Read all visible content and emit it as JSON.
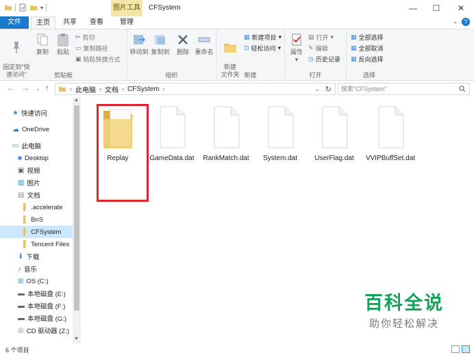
{
  "window": {
    "title": "CFSystem",
    "context_tab": "图片工具",
    "controls": {
      "minimize": "—",
      "maximize": "☐",
      "close": "✕"
    }
  },
  "tabs": [
    {
      "label": "文件"
    },
    {
      "label": "主页"
    },
    {
      "label": "共享"
    },
    {
      "label": "查看"
    },
    {
      "label": "管理"
    }
  ],
  "ribbon": {
    "clipboard": {
      "label": "剪贴板",
      "pin": "固定到\"快速访问\"",
      "copy": "复制",
      "paste": "粘贴",
      "cut": "剪切",
      "copy_path": "复制路径",
      "paste_shortcut": "粘贴快捷方式"
    },
    "organize": {
      "label": "组织",
      "move_to": "移动到",
      "copy_to": "复制到",
      "delete": "删除",
      "rename": "重命名"
    },
    "new": {
      "label": "新建",
      "new_folder": "新建\n文件夹",
      "new_item": "新建项目",
      "easy_access": "轻松访问"
    },
    "open": {
      "label": "打开",
      "properties": "属性",
      "open": "打开",
      "edit": "编辑",
      "history": "历史记录"
    },
    "select": {
      "label": "选择",
      "select_all": "全部选择",
      "select_none": "全部取消",
      "invert": "反向选择"
    }
  },
  "address": {
    "crumbs": [
      "此电脑",
      "文档",
      "CFSystem"
    ],
    "search_placeholder": "搜索\"CFSystem\""
  },
  "nav": [
    {
      "label": "快速访问",
      "icon": "star-icon"
    },
    {
      "label": "OneDrive",
      "icon": "cloud-icon"
    },
    {
      "label": "此电脑",
      "icon": "computer-icon"
    },
    {
      "label": "Desktop",
      "icon": "folder-icon"
    },
    {
      "label": "视频",
      "icon": "video-icon"
    },
    {
      "label": "图片",
      "icon": "picture-icon"
    },
    {
      "label": "文档",
      "icon": "document-icon"
    },
    {
      "label": ".accelerate",
      "icon": "folder-icon"
    },
    {
      "label": "BnS",
      "icon": "folder-icon"
    },
    {
      "label": "CFSystem",
      "icon": "folder-icon"
    },
    {
      "label": "Tencent Files",
      "icon": "folder-icon"
    },
    {
      "label": "下载",
      "icon": "download-icon"
    },
    {
      "label": "音乐",
      "icon": "music-icon"
    },
    {
      "label": "OS (C:)",
      "icon": "drive-icon"
    },
    {
      "label": "本地磁盘 (E:)",
      "icon": "drive-icon"
    },
    {
      "label": "本地磁盘 (F:)",
      "icon": "drive-icon"
    },
    {
      "label": "本地磁盘 (G:)",
      "icon": "drive-icon"
    },
    {
      "label": "CD 驱动器 (Z:)",
      "icon": "cd-icon"
    }
  ],
  "files": [
    {
      "name": "Replay",
      "type": "folder"
    },
    {
      "name": "GameData.dat",
      "type": "file"
    },
    {
      "name": "RankMatch.dat",
      "type": "file"
    },
    {
      "name": "System.dat",
      "type": "file"
    },
    {
      "name": "UserFlag.dat",
      "type": "file"
    },
    {
      "name": "VVIPBuffSet.dat",
      "type": "file"
    }
  ],
  "status": {
    "count": "6 个项目"
  },
  "watermark": {
    "main": "百科全说",
    "sub": "助你轻松解决"
  },
  "colors": {
    "accent": "#1979ca",
    "highlight": "#e0242b",
    "selection": "#cce8ff",
    "watermark": "#18a159"
  }
}
